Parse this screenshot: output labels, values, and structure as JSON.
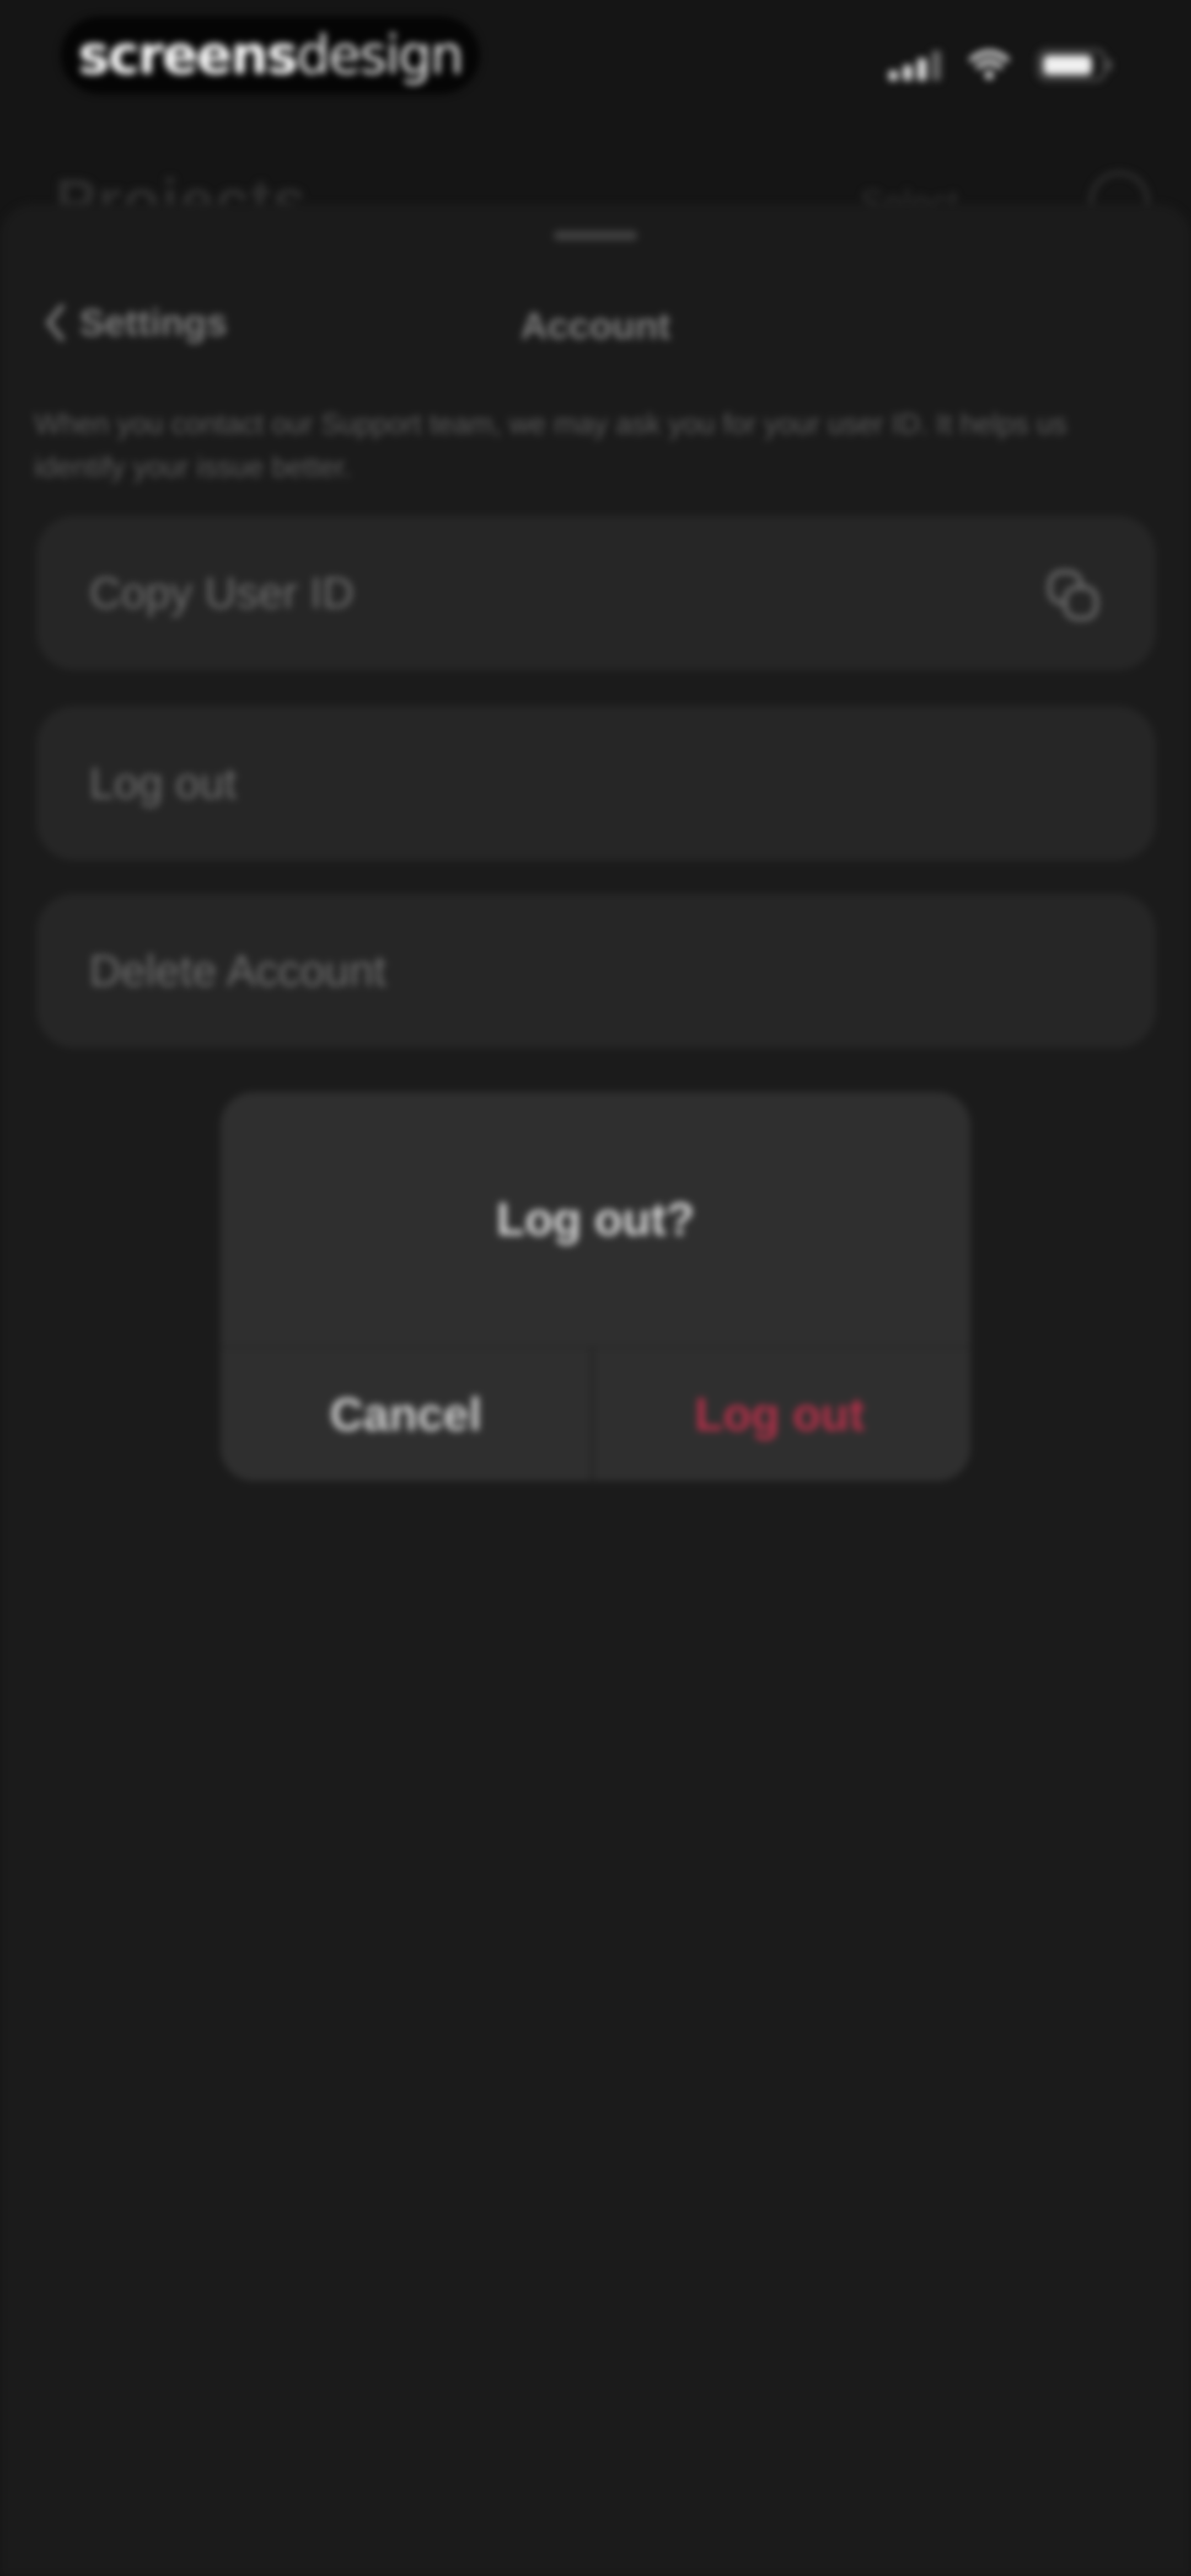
{
  "status_bar": {
    "brand_bold": "screens",
    "brand_light": "design",
    "icons": [
      "cellular-signal-icon",
      "wifi-icon",
      "battery-icon"
    ]
  },
  "background_page": {
    "title": "Projects",
    "action": "Select",
    "icons": [
      "profile-icon"
    ]
  },
  "sheet": {
    "back_label": "Settings",
    "title": "Account",
    "info": "When you contact our Support team, we may ask you for your user ID. It helps us identify your issue better.",
    "items": [
      {
        "label": "Copy User ID",
        "icon": "copy-icon"
      },
      {
        "label": "Log out"
      },
      {
        "label": "Delete Account"
      }
    ]
  },
  "alert": {
    "title": "Log out?",
    "cancel_label": "Cancel",
    "confirm_label": "Log out"
  },
  "colors": {
    "background": "#151515",
    "sheet": "#1b1b1b",
    "row": "#262626",
    "alert": "#2f2f2f",
    "destructive": "#b3314a"
  }
}
